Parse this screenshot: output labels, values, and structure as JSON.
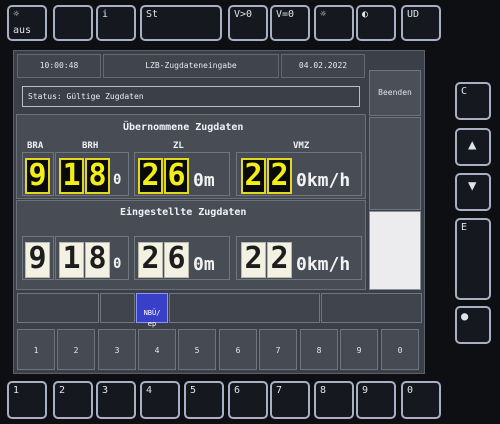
{
  "top_buttons": [
    {
      "label": "☼",
      "sub": "aus",
      "name": "brightness-off-button"
    },
    {
      "label": "",
      "sub": "",
      "name": "top-blank-button-2"
    },
    {
      "label": "i",
      "sub": "",
      "name": "info-button"
    },
    {
      "label": "St",
      "sub": "",
      "name": "st-button"
    },
    {
      "label": "V>0",
      "sub": "",
      "name": "v-greater-zero-button"
    },
    {
      "label": "V=0",
      "sub": "",
      "name": "v-equal-zero-button"
    },
    {
      "label": "☼",
      "sub": "",
      "name": "brightness-button"
    },
    {
      "label": "◐",
      "sub": "",
      "name": "contrast-button"
    },
    {
      "label": "UD",
      "sub": "",
      "name": "ud-button"
    }
  ],
  "header": {
    "time": "10:00:48",
    "title": "LZB-Zugdateneingabe",
    "date": "04.02.2022"
  },
  "status": "Status: Gültige Zugdaten",
  "side": {
    "end_label": "Beenden"
  },
  "right_buttons": [
    {
      "label": "C",
      "name": "clear-button"
    },
    {
      "label": "▲",
      "name": "up-button"
    },
    {
      "label": "▼",
      "name": "down-button"
    },
    {
      "label": "E",
      "name": "enter-button"
    },
    {
      "label": "●",
      "name": "dot-button"
    }
  ],
  "adopted": {
    "title": "Übernommene Zugdaten",
    "bra_label": "BRA",
    "brh_label": "BRH",
    "zl_label": "ZL",
    "vmz_label": "VMZ",
    "bra": "9",
    "brh": [
      "1",
      "8"
    ],
    "zl": [
      "2",
      "6"
    ],
    "vmz": [
      "2",
      "2"
    ],
    "brh_unit": "0",
    "zl_unit": "0m",
    "vmz_unit": "0km/h"
  },
  "set": {
    "title": "Eingestellte Zugdaten",
    "bra": "9",
    "brh": [
      "1",
      "8"
    ],
    "zl": [
      "2",
      "6"
    ],
    "vmz": [
      "2",
      "2"
    ],
    "brh_unit": "0",
    "zl_unit": "0m",
    "vmz_unit": "0km/h"
  },
  "softkey": "NBÜ/\nep",
  "keypad": [
    "1",
    "2",
    "3",
    "4",
    "5",
    "6",
    "7",
    "8",
    "9",
    "0"
  ],
  "bottom_buttons": [
    "1",
    "2",
    "3",
    "4",
    "5",
    "6",
    "7",
    "8",
    "9",
    "0"
  ],
  "colors": {
    "accent": "#f2ee18",
    "softkey": "#3940c8"
  }
}
